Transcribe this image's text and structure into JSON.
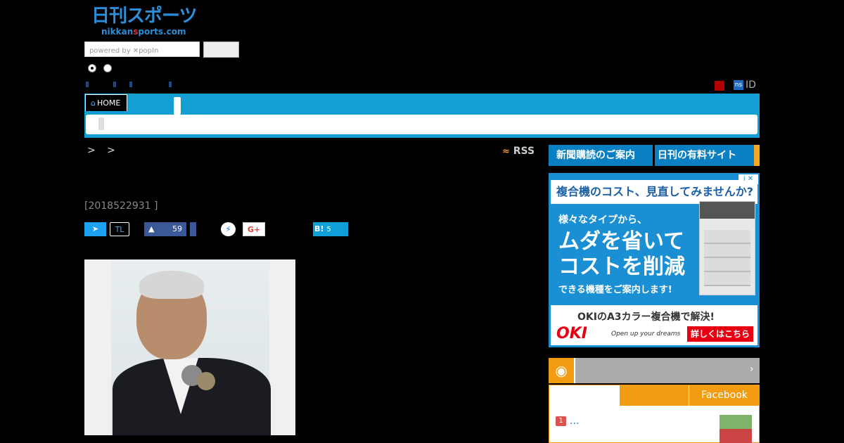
{
  "logo": {
    "line1": "日刊スポーツ",
    "line2_pre": "nikkan",
    "line2_mid": "s",
    "line2_post": "ports.com"
  },
  "search": {
    "placeholder": "powered by ✕popIn",
    "button_label": ""
  },
  "user": {
    "ns_badge": "ns",
    "id_label": "ID"
  },
  "nav": {
    "home_label": "HOME",
    "home_icon": "home-icon"
  },
  "breadcrumb": {
    "text": "> >"
  },
  "rss": {
    "label": "RSS",
    "icon": "rss-icon"
  },
  "article": {
    "date": "[2018522931 ]",
    "social": {
      "twitter_icon": "twitter-icon",
      "tl_label": "TL",
      "like_count": "59",
      "messenger_icon": "messenger-icon",
      "gplus_label": "G+",
      "hatena_label": "B!",
      "hatena_count": "5"
    }
  },
  "sidebar": {
    "subscribe_label": "新聞購読のご案内",
    "paid_site_label": "日刊の有料サイト",
    "ad": {
      "header": "複合機のコスト、見直してみませんか?",
      "sub1": "様々なタイプから、",
      "big1": "ムダを省いて",
      "big2": "コストを削減",
      "sub2": "できる機種をご案内します!",
      "foot_text": "OKIのA3カラー複合機で解決!",
      "brand": "OKI",
      "slogan": "Open up your dreams",
      "cta": "詳しくはこちら"
    },
    "ranking": {
      "chevron": "›",
      "facebook_tab": "Facebook",
      "items": [
        {
          "rank": "1",
          "text": "..."
        }
      ]
    }
  },
  "colors": {
    "nav_blue": "#139ed4",
    "accent_orange": "#f39c12",
    "subscribe_blue": "#0a7fc2",
    "oki_red": "#e60012"
  }
}
